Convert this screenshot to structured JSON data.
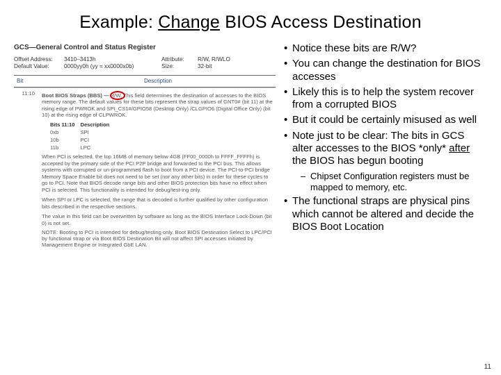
{
  "title_pre": "Example: ",
  "title_u": "Change",
  "title_post": " BIOS Access Destination",
  "pagenum": "11",
  "bullets": [
    "Notice these bits are R/W?",
    "You can change the destination for BIOS accesses",
    "Likely this is to help the system recover from a corrupted BIOS",
    "But it could be certainly misused as well"
  ],
  "bullet_note_pre": "Note just to be clear: The bits in GCS alter accesses to the BIOS *only* ",
  "bullet_note_u": "after",
  "bullet_note_post": " the BIOS has begun booting",
  "sub_bullet": "Chipset Configuration registers must be mapped to memory, etc.",
  "last_bullet": "The functional straps are physical pins which cannot be altered and decide the BIOS Boot Location",
  "gcs_head": "GCS—General Control and Status Register",
  "attrs": {
    "offset_lab": "Offset Address:",
    "offset_val": "3410–3413h",
    "attr_lab": "Attribute:",
    "attr_val": "R/W, R/WLO",
    "def_lab": "Default Value:",
    "def_val": "0000yy0h (yy = xx0000x0b)",
    "size_lab": "Size:",
    "size_val": "32-bit"
  },
  "tbl_h_bit": "Bit",
  "tbl_h_desc": "Description",
  "bbs_pre": "Boot BIOS Straps (BBS) — ",
  "bbs_rw": "R/W.",
  "bbs_post1": " This field determines the destination of accesses to the BIOS memory range. The default values for these bits represent the strap values of GNT0# (bit 11) at the rising edge of PWROK and SPI_CS1#/GPIO58 (Desktop Only) /CLGPIO6 (Digital Office Only) (bit 10) at the rising edge of CLPWROK.",
  "mini": {
    "h_bits": "Bits 11:10",
    "h_desc": "Description",
    "r0b": "0xb",
    "r0d": "SPI",
    "r1b": "10b",
    "r1d": "PCI",
    "r2b": "11b",
    "r2d": "LPC"
  },
  "bitnum": "11:10",
  "p_pci": "When PCI is selected, the top 16MB of memory below 4GB (FF00_0000h to FFFF_FFFFh) is accepted by the primary side of the PCI P2P bridge and forwarded to the PCI bus. This allows systems with corrupted or un-programmed flash to boot from a PCI device. The PCI-to-PCI bridge Memory Space Enable bit does not need to be set (nor any other bits) in order for these cycles to go to PCI. Note that BIOS decode range bits and other BIOS protection bits have no effect when PCI is selected. This functionality is intended for debug/test-ing only.",
  "p_spi": "When SPI or LPC is selected, the range that is decoded is further qualified by other configuration bits described in the respective sections.",
  "p_over": "The value in this field can be overwritten by software as long as the BIOS Interface Lock-Down (bit 0) is not set.",
  "note_lab": "NOTE:",
  "note_txt": " Booting to PCI is intended for debug/testing only. Boot BIOS Destination Select to LPC/PCI by functional strap or via Boot BIOS Destination Bit will not affect SPI accesses initiated by Management Engine or Integrated GbE LAN."
}
